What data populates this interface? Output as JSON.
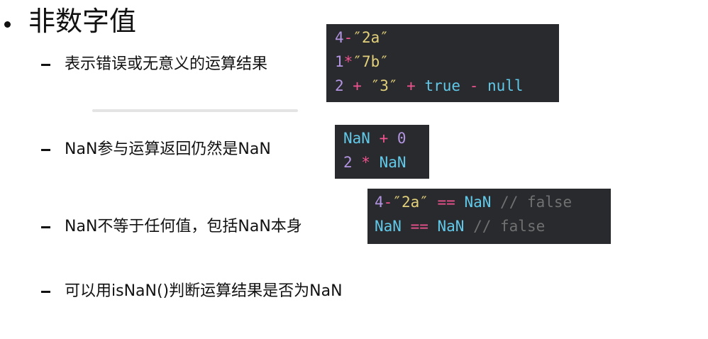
{
  "title": "非数字值",
  "items": [
    {
      "text": "表示错误或无意义的运算结果"
    },
    {
      "text": "NaN参与运算返回仍然是NaN"
    },
    {
      "text": "NaN不等于任何值，包括NaN本身"
    },
    {
      "text": "可以用isNaN()判断运算结果是否为NaN"
    }
  ],
  "code_blocks": [
    {
      "lines": [
        {
          "tokens": [
            {
              "t": "4",
              "k": "num"
            },
            {
              "t": "-",
              "k": "op"
            },
            {
              "t": "″2a″",
              "k": "str"
            }
          ]
        },
        {
          "tokens": [
            {
              "t": "1",
              "k": "num"
            },
            {
              "t": "*",
              "k": "op"
            },
            {
              "t": "″7b″",
              "k": "str"
            }
          ]
        },
        {
          "tokens": [
            {
              "t": "2",
              "k": "num"
            },
            {
              "t": " + ",
              "k": "op"
            },
            {
              "t": "″3″",
              "k": "str"
            },
            {
              "t": " + ",
              "k": "op"
            },
            {
              "t": "true",
              "k": "kw"
            },
            {
              "t": " - ",
              "k": "op"
            },
            {
              "t": "null",
              "k": "kw"
            }
          ]
        }
      ]
    },
    {
      "lines": [
        {
          "tokens": [
            {
              "t": "NaN",
              "k": "kw"
            },
            {
              "t": " + ",
              "k": "op"
            },
            {
              "t": "0",
              "k": "num"
            }
          ]
        },
        {
          "tokens": [
            {
              "t": "2",
              "k": "num"
            },
            {
              "t": " * ",
              "k": "op"
            },
            {
              "t": "NaN",
              "k": "kw"
            }
          ]
        }
      ]
    },
    {
      "lines": [
        {
          "tokens": [
            {
              "t": "4",
              "k": "num"
            },
            {
              "t": "-",
              "k": "op"
            },
            {
              "t": "″2a″",
              "k": "str"
            },
            {
              "t": " == ",
              "k": "op"
            },
            {
              "t": "NaN",
              "k": "kw"
            },
            {
              "t": " // false",
              "k": "com"
            }
          ]
        },
        {
          "tokens": [
            {
              "t": "NaN",
              "k": "kw"
            },
            {
              "t": " == ",
              "k": "op"
            },
            {
              "t": "NaN",
              "k": "kw"
            },
            {
              "t": " // false",
              "k": "com"
            }
          ]
        }
      ]
    }
  ]
}
